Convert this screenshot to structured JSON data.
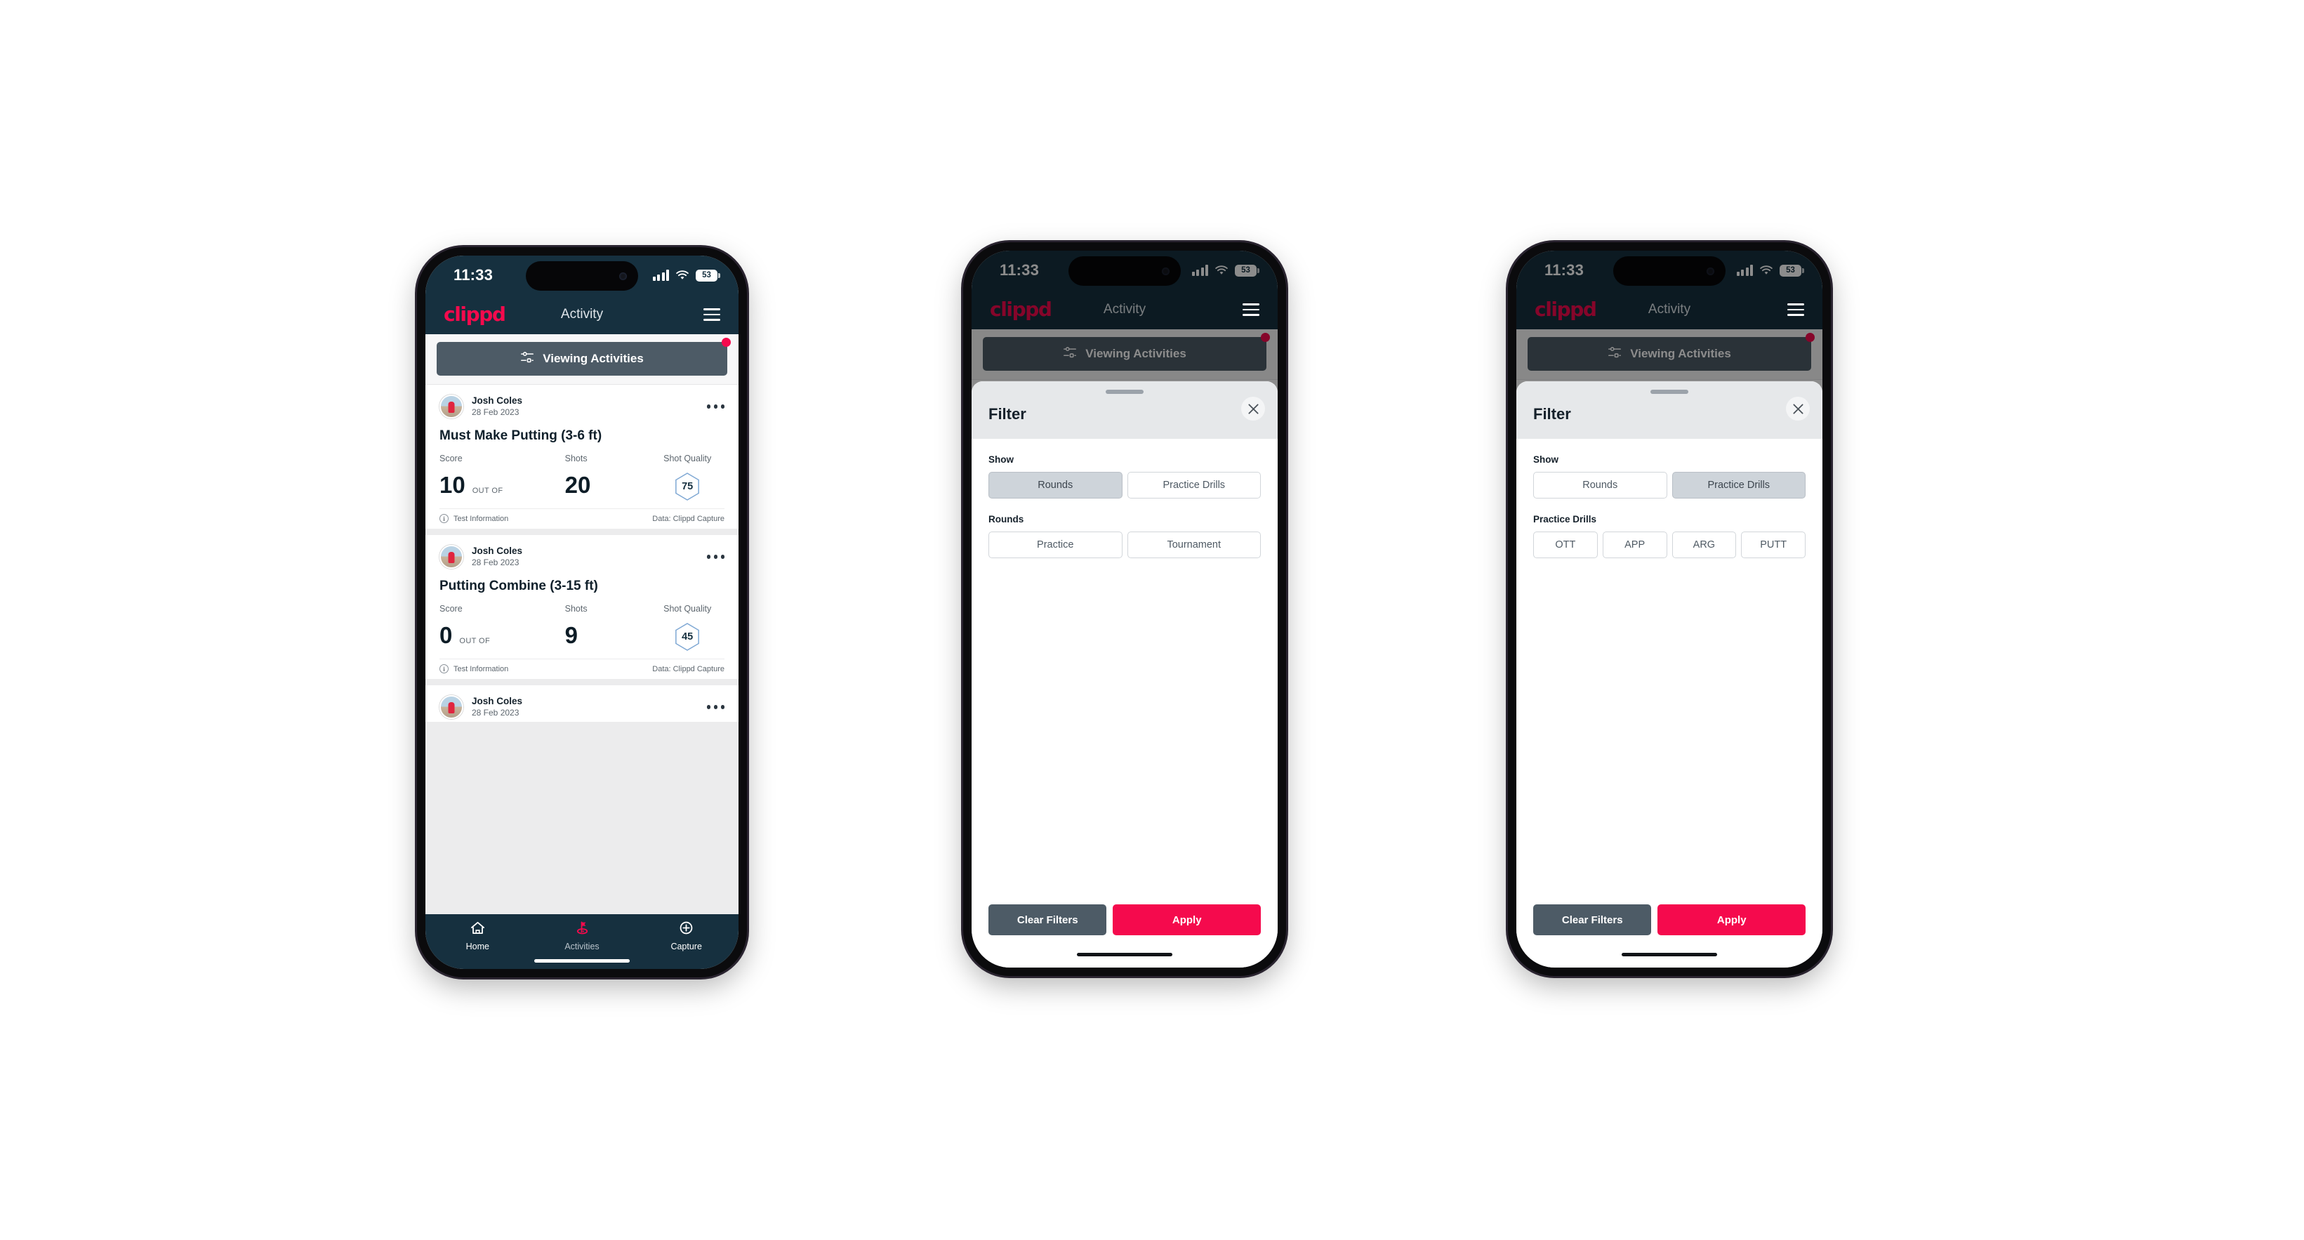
{
  "status_bar": {
    "time": "11:33",
    "battery": "53",
    "signal_icon": "cellular-signal-icon",
    "wifi_icon": "wifi-icon",
    "battery_icon": "battery-icon"
  },
  "app_bar": {
    "logo": "clippd",
    "title": "Activity",
    "menu_icon": "hamburger-menu-icon"
  },
  "filter_strip": {
    "button_label": "Viewing Activities",
    "icon": "filter-sliders-icon",
    "has_badge": true
  },
  "feed": {
    "cards": [
      {
        "user": "Josh Coles",
        "date": "28 Feb 2023",
        "title": "Must Make Putting (3-6 ft)",
        "score_label": "Score",
        "shots_label": "Shots",
        "quality_label": "Shot Quality",
        "score": "10",
        "out_of": "OUT OF",
        "shots": "20",
        "quality": "75",
        "footer_left": "Test Information",
        "footer_right": "Data: Clippd Capture"
      },
      {
        "user": "Josh Coles",
        "date": "28 Feb 2023",
        "title": "Putting Combine (3-15 ft)",
        "score_label": "Score",
        "shots_label": "Shots",
        "quality_label": "Shot Quality",
        "score": "0",
        "out_of": "OUT OF",
        "shots": "9",
        "quality": "45",
        "footer_left": "Test Information",
        "footer_right": "Data: Clippd Capture"
      },
      {
        "user": "Josh Coles",
        "date": "28 Feb 2023"
      }
    ]
  },
  "bottom_nav": {
    "items": [
      {
        "label": "Home",
        "icon": "home-icon",
        "active": false
      },
      {
        "label": "Activities",
        "icon": "golf-flag-icon",
        "active": true
      },
      {
        "label": "Capture",
        "icon": "plus-circle-icon",
        "active": false
      }
    ]
  },
  "filter_sheet_rounds": {
    "title": "Filter",
    "close_icon": "close-icon",
    "grabber": "drag-handle",
    "show_label": "Show",
    "show_options": [
      {
        "label": "Rounds",
        "selected": true
      },
      {
        "label": "Practice Drills",
        "selected": false
      }
    ],
    "group_label": "Rounds",
    "group_options": [
      {
        "label": "Practice",
        "selected": false
      },
      {
        "label": "Tournament",
        "selected": false
      }
    ],
    "clear_label": "Clear Filters",
    "apply_label": "Apply"
  },
  "filter_sheet_drills": {
    "title": "Filter",
    "close_icon": "close-icon",
    "grabber": "drag-handle",
    "show_label": "Show",
    "show_options": [
      {
        "label": "Rounds",
        "selected": false
      },
      {
        "label": "Practice Drills",
        "selected": true
      }
    ],
    "group_label": "Practice Drills",
    "group_options": [
      {
        "label": "OTT",
        "selected": false
      },
      {
        "label": "APP",
        "selected": false
      },
      {
        "label": "ARG",
        "selected": false
      },
      {
        "label": "PUTT",
        "selected": false
      }
    ],
    "clear_label": "Clear Filters",
    "apply_label": "Apply"
  },
  "colors": {
    "brand_pink": "#f50a4d",
    "header_navy": "#16303f",
    "slate": "#4d5b66",
    "hex_border": "#7fa8d4"
  }
}
